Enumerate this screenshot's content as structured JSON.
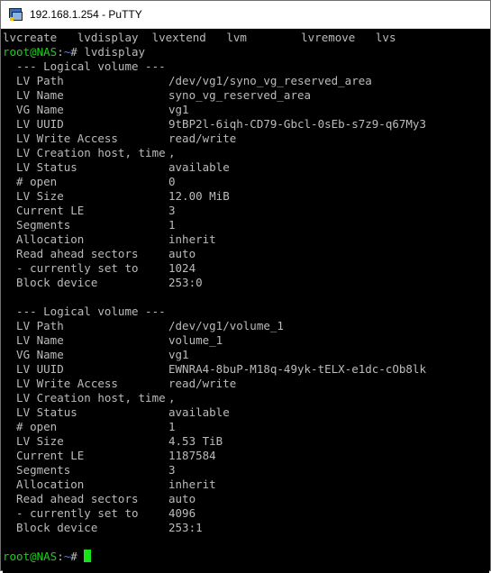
{
  "window": {
    "title": "192.168.1.254 - PuTTY"
  },
  "terminal": {
    "completion_line": "lvcreate   lvdisplay  lvextend   lvm        lvremove   lvs",
    "prompt": {
      "user_host": "root@NAS",
      "sep": ":",
      "cwd": "~",
      "symbol": "# "
    },
    "command": "lvdisplay",
    "volumes": [
      {
        "header": "  --- Logical volume ---",
        "fields": [
          {
            "label": "  LV Path",
            "value": "/dev/vg1/syno_vg_reserved_area"
          },
          {
            "label": "  LV Name",
            "value": "syno_vg_reserved_area"
          },
          {
            "label": "  VG Name",
            "value": "vg1"
          },
          {
            "label": "  LV UUID",
            "value": "9tBP2l-6iqh-CD79-Gbcl-0sEb-s7z9-q67My3"
          },
          {
            "label": "  LV Write Access",
            "value": "read/write"
          },
          {
            "label": "  LV Creation host, time",
            "value": ","
          },
          {
            "label": "  LV Status",
            "value": "available"
          },
          {
            "label": "  # open",
            "value": "0"
          },
          {
            "label": "  LV Size",
            "value": "12.00 MiB"
          },
          {
            "label": "  Current LE",
            "value": "3"
          },
          {
            "label": "  Segments",
            "value": "1"
          },
          {
            "label": "  Allocation",
            "value": "inherit"
          },
          {
            "label": "  Read ahead sectors",
            "value": "auto"
          },
          {
            "label": "  - currently set to",
            "value": "1024"
          },
          {
            "label": "  Block device",
            "value": "253:0"
          }
        ]
      },
      {
        "header": "  --- Logical volume ---",
        "fields": [
          {
            "label": "  LV Path",
            "value": "/dev/vg1/volume_1"
          },
          {
            "label": "  LV Name",
            "value": "volume_1"
          },
          {
            "label": "  VG Name",
            "value": "vg1"
          },
          {
            "label": "  LV UUID",
            "value": "EWNRA4-8buP-M18q-49yk-tELX-e1dc-cOb8lk"
          },
          {
            "label": "  LV Write Access",
            "value": "read/write"
          },
          {
            "label": "  LV Creation host, time",
            "value": ","
          },
          {
            "label": "  LV Status",
            "value": "available"
          },
          {
            "label": "  # open",
            "value": "1"
          },
          {
            "label": "  LV Size",
            "value": "4.53 TiB"
          },
          {
            "label": "  Current LE",
            "value": "1187584"
          },
          {
            "label": "  Segments",
            "value": "3"
          },
          {
            "label": "  Allocation",
            "value": "inherit"
          },
          {
            "label": "  Read ahead sectors",
            "value": "auto"
          },
          {
            "label": "  - currently set to",
            "value": "4096"
          },
          {
            "label": "  Block device",
            "value": "253:1"
          }
        ]
      }
    ]
  }
}
